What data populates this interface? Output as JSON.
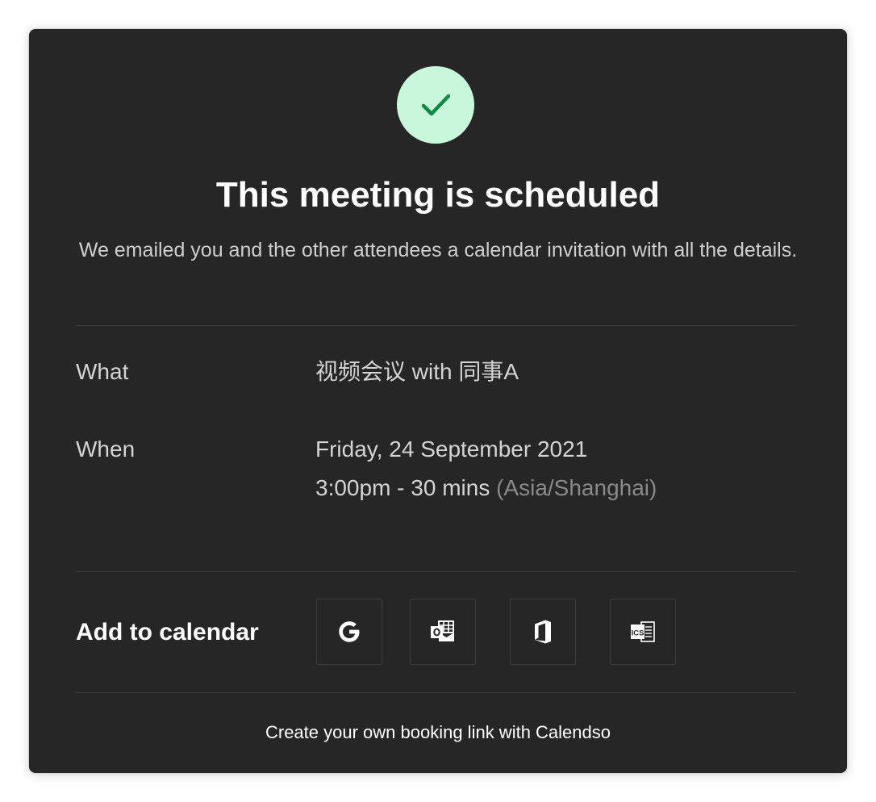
{
  "success_icon": "check-icon",
  "colors": {
    "card_bg": "#262626",
    "success_circle": "#c9f7dc",
    "success_check": "#0e8a45"
  },
  "header": {
    "title": "This meeting is scheduled",
    "subtitle": "We emailed you and the other attendees a calendar invitation with all the details."
  },
  "details": {
    "what_label": "What",
    "what_value": "视频会议 with 同事A",
    "when_label": "When",
    "when_date": "Friday, 24 September 2021",
    "when_time": "3:00pm - 30 mins",
    "when_timezone": "(Asia/Shanghai)"
  },
  "add_to_calendar": {
    "label": "Add to calendar",
    "buttons": [
      {
        "icon": "google-icon"
      },
      {
        "icon": "outlook-icon"
      },
      {
        "icon": "office365-icon"
      },
      {
        "icon": "ics-icon",
        "text": "ICS"
      }
    ]
  },
  "footer": {
    "link_text": "Create your own booking link with Calendso"
  }
}
